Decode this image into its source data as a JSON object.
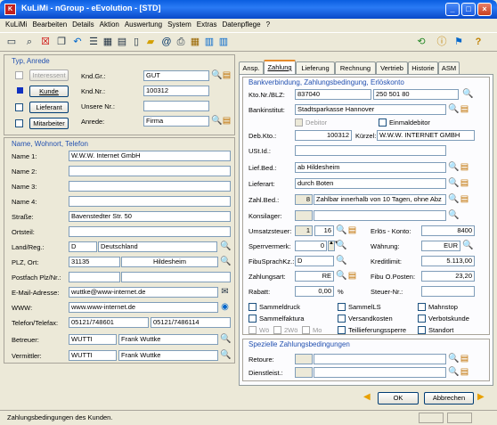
{
  "window": {
    "title": "KuLiMi - nGroup - eEvolution - [STD]",
    "app_icon": "K",
    "minimize": "_",
    "maximize": "□",
    "close": "×"
  },
  "menu": [
    "KuLiMi",
    "Bearbeiten",
    "Details",
    "Aktion",
    "Auswertung",
    "System",
    "Extras",
    "Datenpflege",
    "?"
  ],
  "typ_anrede": {
    "title": "Typ, Anrede",
    "btn_interessent": "Interessent",
    "btn_kunde": "Kunde",
    "btn_lieferant": "Lieferant",
    "btn_mitarbeiter": "Mitarbeiter",
    "lbl_kndgr": "Knd.Gr.:",
    "kndgr": "GUT",
    "lbl_kndnr": "Knd.Nr.:",
    "kndnr": "100312",
    "lbl_unsere": "Unsere Nr.:",
    "unsere": "",
    "lbl_anrede": "Anrede:",
    "anrede": "Firma"
  },
  "name_wohnort": {
    "title": "Name, Wohnort, Telefon",
    "lbl_name1": "Name 1:",
    "name1": "W.W.W. Internet GmbH",
    "lbl_name2": "Name 2:",
    "name2": "",
    "lbl_name3": "Name 3:",
    "name3": "",
    "lbl_name4": "Name 4:",
    "name4": "",
    "lbl_strasse": "Straße:",
    "strasse": "Bavenstedter Str. 50",
    "lbl_ortsteil": "Ortsteil:",
    "ortsteil": "",
    "lbl_land": "Land/Reg.:",
    "land_code": "D",
    "land": "Deutschland",
    "lbl_plz": "PLZ, Ort:",
    "plz": "31135",
    "ort": "Hildesheim",
    "lbl_postfach": "Postfach Plz/Nr.:",
    "postfach_plz": "",
    "postfach_nr": "",
    "lbl_email": "E-Mail-Adresse:",
    "email": "wuttke@www-internet.de",
    "lbl_www": "WWW:",
    "www": "www.www-internet.de",
    "lbl_tel": "Telefon/Telefax:",
    "telefon": "05121/748601",
    "telefax": "05121/7486114",
    "lbl_betreuer": "Betreuer:",
    "betreuer_code": "WUTTI",
    "betreuer": "Frank Wuttke",
    "lbl_vermittler": "Vermittler:",
    "vermittler_code": "WUTTI",
    "vermittler": "Frank Wuttke"
  },
  "tabs": [
    "Ansp.",
    "Zahlung",
    "Lieferung",
    "Rechnung",
    "Vertrieb",
    "Historie",
    "ASM"
  ],
  "zahlung": {
    "title": "Bankverbindung, Zahlungsbedingung, Erlöskonto",
    "lbl_kto": "Kto.Nr./BLZ:",
    "kto": "837040",
    "blz": "250 501 80",
    "lbl_bank": "Bankinstitut:",
    "bank": "Stadtsparkasse Hannover",
    "debitor": "Debitor",
    "einmaldebitor": "Einmaldebitor",
    "lbl_debkto": "Deb.Kto.:",
    "debkto": "100312",
    "lbl_kurzel": "Kürzel:",
    "kurzel": "W.W.W. INTERNET GMBH",
    "lbl_ustid": "USt.Id.:",
    "ustid": "",
    "lbl_liefbed": "Lief.Bed.:",
    "liefbed": "ab Hildesheim",
    "lbl_lieferart": "Lieferart:",
    "lieferart": "durch Boten",
    "lbl_zahlbed": "Zahl.Bed.:",
    "zahlbed_nr": "8",
    "zahlbed": "Zahlbar innerhalb von 10 Tagen, ohne Abz",
    "lbl_konsilager": "Konsilager:",
    "konsilager": "",
    "lbl_umsatzsteuer": "Umsatzsteuer:",
    "ust1": "1",
    "ust2": "16",
    "lbl_erloes": "Erlös - Konto:",
    "erloes": "8400",
    "lbl_sperr": "Sperrvermerk:",
    "sperr": "0",
    "lbl_waehrung": "Währung:",
    "waehrung": "EUR",
    "lbl_fibu": "FibuSprachKz.:",
    "fibu": "D",
    "lbl_kredit": "Kreditlimit:",
    "kredit": "5.113,00",
    "lbl_zahlungsart": "Zahlungsart:",
    "zahlungsart": "RE",
    "lbl_fibuop": "Fibu O.Posten:",
    "fibuop": "23,20",
    "lbl_rabatt": "Rabatt:",
    "rabatt": "0,00",
    "percent": "%",
    "lbl_steuernr": "Steuer-Nr.:",
    "steuernr": "",
    "chk": [
      "Sammeldruck",
      "SammelLS",
      "Mahnstop",
      "Sammelfaktura",
      "Versandkosten",
      "Verbotskunde",
      "Wö",
      "2Wö",
      "Mo",
      "Teillieferungssperre",
      "Standort"
    ]
  },
  "spezielle": {
    "title": "Spezielle Zahlungsbedingungen",
    "lbl_retoure": "Retoure:",
    "lbl_dienst": "Dienstleist.:"
  },
  "buttons": {
    "ok": "OK",
    "abbrechen": "Abbrechen"
  },
  "status": "Zahlungsbedingungen des Kunden."
}
